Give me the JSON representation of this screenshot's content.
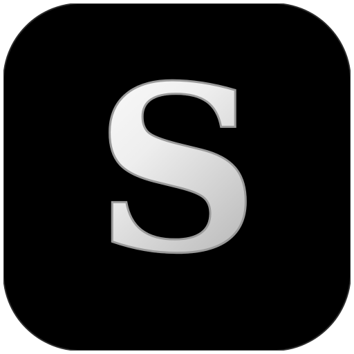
{
  "icon": {
    "name": "s-letter-app-icon",
    "letter": "S",
    "colors": {
      "tile": "#000000",
      "tile_edge": "#3a3a3a",
      "glyph_light": "#ffffff",
      "glyph_mid": "#e6e6e6",
      "glyph_dark": "#a8a8a8"
    }
  }
}
